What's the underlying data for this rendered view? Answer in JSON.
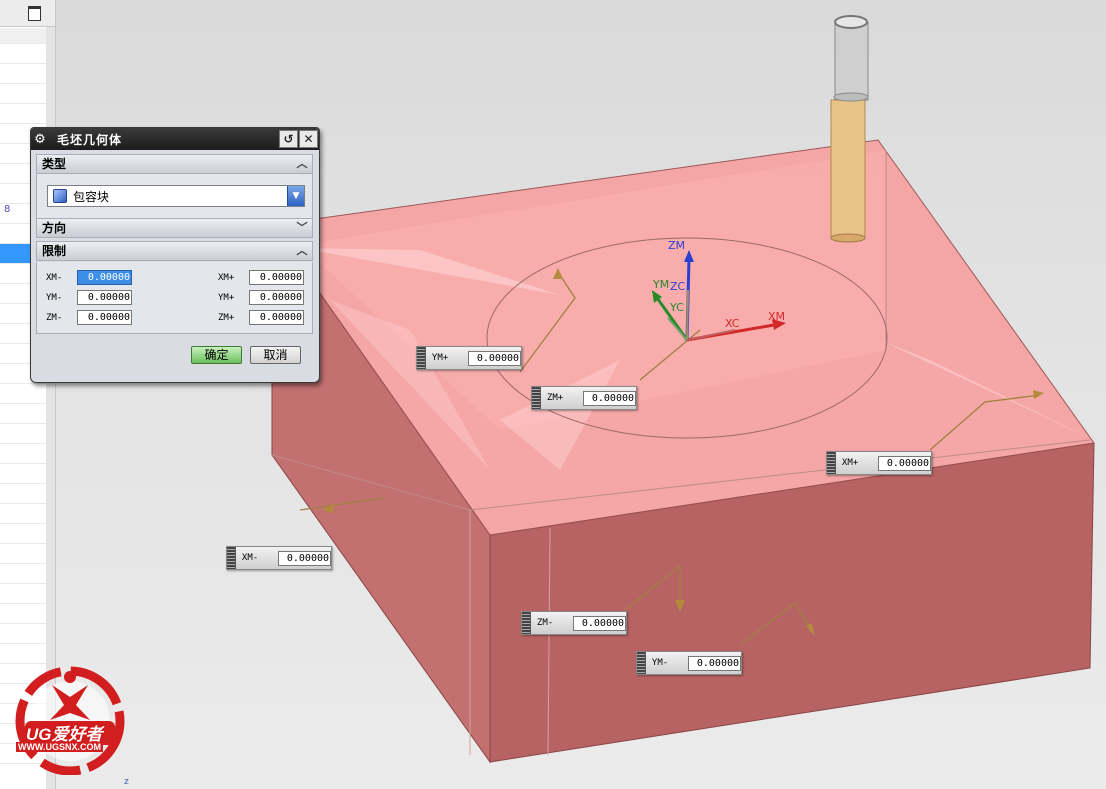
{
  "window": {
    "restore_icon": "restore-window-icon"
  },
  "navigator": {
    "fragment_number": "8",
    "bottom_mark": "z"
  },
  "dialog": {
    "title": "毛坯几何体",
    "icons": {
      "settings": "gear-icon",
      "reset": "reset-icon",
      "close": "close-icon"
    },
    "sections": {
      "type": {
        "label": "类型",
        "expanded": true
      },
      "direction": {
        "label": "方向",
        "expanded": false
      },
      "limits": {
        "label": "限制",
        "expanded": true
      }
    },
    "type_select": {
      "value": "包容块",
      "icon": "bounding-block-icon"
    },
    "limits": [
      {
        "label": "XM-",
        "value": "0.00000"
      },
      {
        "label": "XM+",
        "value": "0.00000"
      },
      {
        "label": "YM-",
        "value": "0.00000"
      },
      {
        "label": "YM+",
        "value": "0.00000"
      },
      {
        "label": "ZM-",
        "value": "0.00000"
      },
      {
        "label": "ZM+",
        "value": "0.00000"
      }
    ],
    "ok_label": "确定",
    "cancel_label": "取消"
  },
  "viewport": {
    "axes": {
      "zm": "ZM",
      "zc": "ZC",
      "ym": "YM",
      "yc": "YC",
      "xc": "XC",
      "xm": "XM"
    },
    "handles": [
      {
        "label": "YM+",
        "value": "0.00000"
      },
      {
        "label": "ZM+",
        "value": "0.00000"
      },
      {
        "label": "XM+",
        "value": "0.00000"
      },
      {
        "label": "XM-",
        "value": "0.00000"
      },
      {
        "label": "ZM-",
        "value": "0.00000"
      },
      {
        "label": "YM-",
        "value": "0.00000"
      }
    ],
    "colors": {
      "block_top": "#f7a3a3",
      "block_side": "#b86464",
      "tool": "#c8c8c8",
      "holder": "#e8c489"
    }
  },
  "watermark": {
    "brand": "UG爱好者",
    "url": "WWW.UGSNX.COM"
  }
}
